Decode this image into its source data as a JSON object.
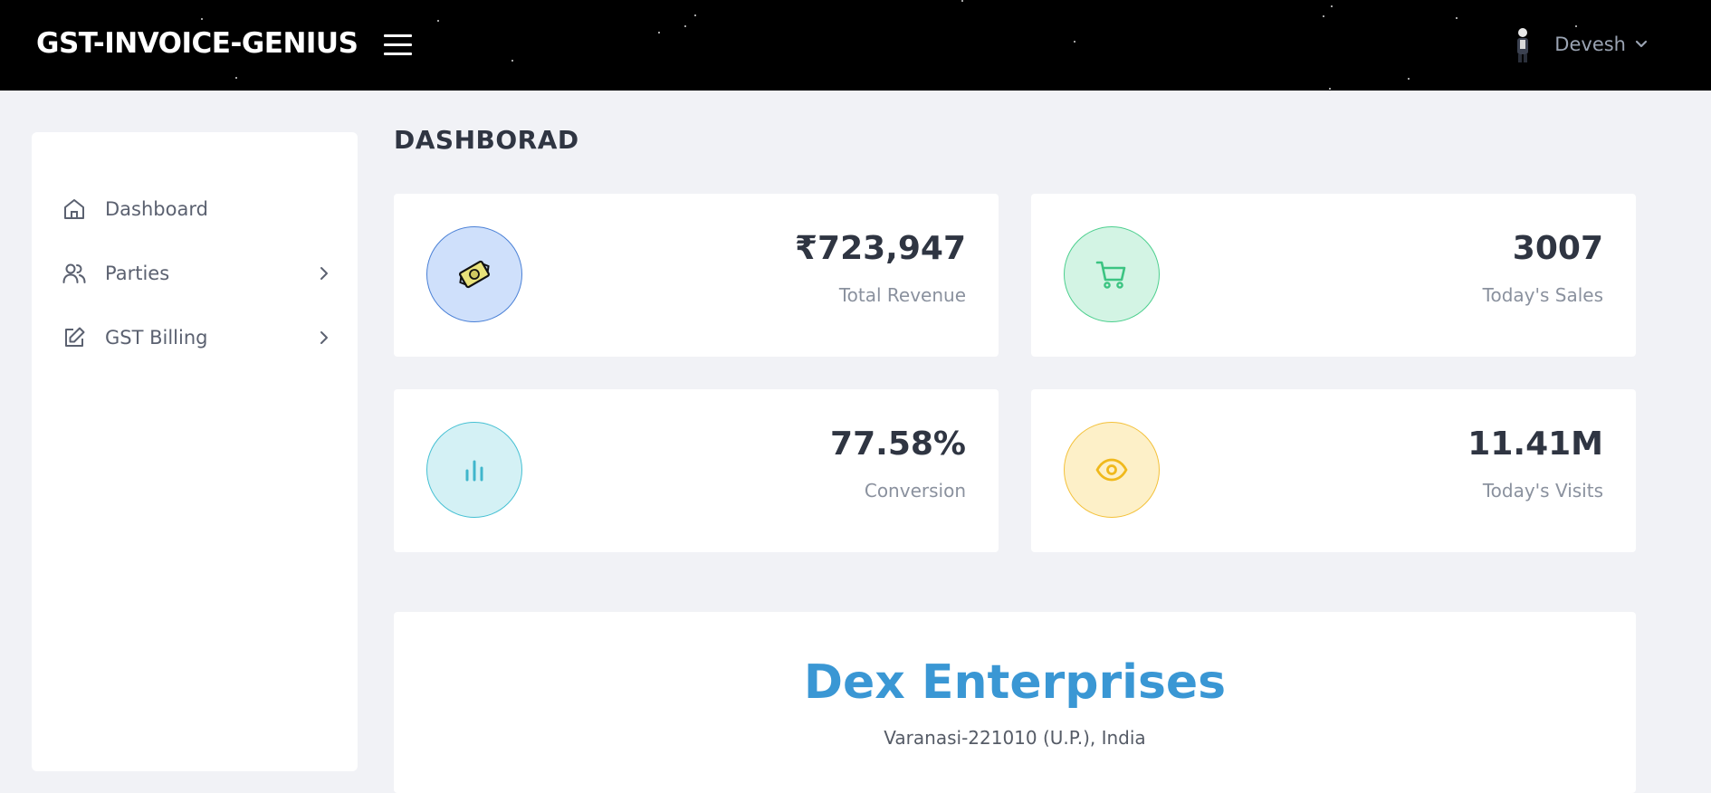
{
  "header": {
    "brand": "GST-INVOICE-GENIUS",
    "user": {
      "name": "Devesh"
    }
  },
  "sidebar": {
    "items": [
      {
        "label": "Dashboard",
        "icon": "home-icon",
        "has_submenu": false
      },
      {
        "label": "Parties",
        "icon": "users-icon",
        "has_submenu": true
      },
      {
        "label": "GST Billing",
        "icon": "edit-icon",
        "has_submenu": true
      }
    ]
  },
  "main": {
    "title": "DASHBORAD",
    "stats": [
      {
        "value": "₹723,947",
        "caption": "Total Revenue",
        "icon": "money-icon",
        "color": "#cfe0fb"
      },
      {
        "value": "3007",
        "caption": "Today's Sales",
        "icon": "cart-icon",
        "color": "#d3f4e4"
      },
      {
        "value": "77.58%",
        "caption": "Conversion",
        "icon": "bar-chart-icon",
        "color": "#d4f1f5"
      },
      {
        "value": "11.41M",
        "caption": "Today's Visits",
        "icon": "eye-icon",
        "color": "#fdf0c8"
      }
    ],
    "company": {
      "name": "Dex Enterprises",
      "address": "Varanasi-221010 (U.P.), India"
    }
  },
  "colors": {
    "accent": "#3a97d4",
    "topbar": "#000000",
    "background": "#f1f2f6"
  }
}
